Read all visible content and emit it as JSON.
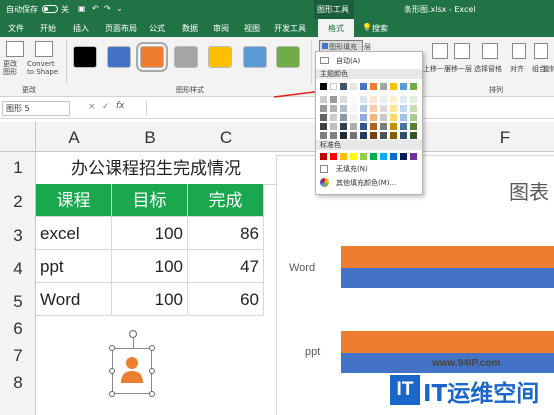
{
  "titlebar": {
    "autosave": "自动保存",
    "autosave_state": "关",
    "context_group": "图形工具",
    "file_title": "条形图.xlsx - Excel"
  },
  "tabs": [
    "文件",
    "开始",
    "插入",
    "页面布局",
    "公式",
    "数据",
    "审阅",
    "视图",
    "开发工具"
  ],
  "format_tab": "格式",
  "search": "搜索",
  "ribbon": {
    "change_shape": "更改\n图形",
    "convert_to_shape": "Convert\nto Shape",
    "group_change": "更改",
    "group_styles": "图形样式",
    "fill_button": "图形填充",
    "bring_forward": "上移一层",
    "send_backward": "下移一层",
    "selection_pane": "选择窗格",
    "align": "对齐",
    "group": "组合",
    "rotate": "旋转",
    "group_arrange": "排列",
    "style_swatches": [
      "#000000",
      "#4472c4",
      "#ed7d31",
      "#a5a5a5",
      "#ffc000",
      "#5b9bd5",
      "#70ad47"
    ]
  },
  "name_box": "图形 5",
  "formula_icons": {
    "cancel": "×",
    "enter": "✓",
    "fx": "fx"
  },
  "columns": [
    "A",
    "B",
    "C",
    "F"
  ],
  "rows": [
    "1",
    "2",
    "3",
    "4",
    "5",
    "6",
    "7",
    "8"
  ],
  "sheet": {
    "title": "办公课程招生完成情况",
    "headers": [
      "课程",
      "目标",
      "完成"
    ],
    "data": [
      [
        "excel",
        "100",
        "86"
      ],
      [
        "ppt",
        "100",
        "47"
      ],
      [
        "Word",
        "100",
        "60"
      ]
    ]
  },
  "chart": {
    "title_partial": "图表",
    "categories": [
      "Word",
      "ppt"
    ]
  },
  "fill_menu": {
    "auto": "自动(A)",
    "theme_colors": "主题颜色",
    "standard_colors": "标准色",
    "no_fill": "无填充(N)",
    "more_colors": "其他填充颜色(M)...",
    "theme_row": [
      "#000000",
      "#ffffff",
      "#44546a",
      "#e7e6e6",
      "#4472c4",
      "#ed7d31",
      "#a5a5a5",
      "#ffc000",
      "#5b9bd5",
      "#70ad47"
    ],
    "standard_row": [
      "#c00000",
      "#ff0000",
      "#ffc000",
      "#ffff00",
      "#92d050",
      "#00b050",
      "#00b0f0",
      "#0070c0",
      "#002060",
      "#7030a0"
    ]
  },
  "watermark": {
    "url": "www.94IP.com",
    "logo": "IT",
    "text": "IT运维空间"
  }
}
